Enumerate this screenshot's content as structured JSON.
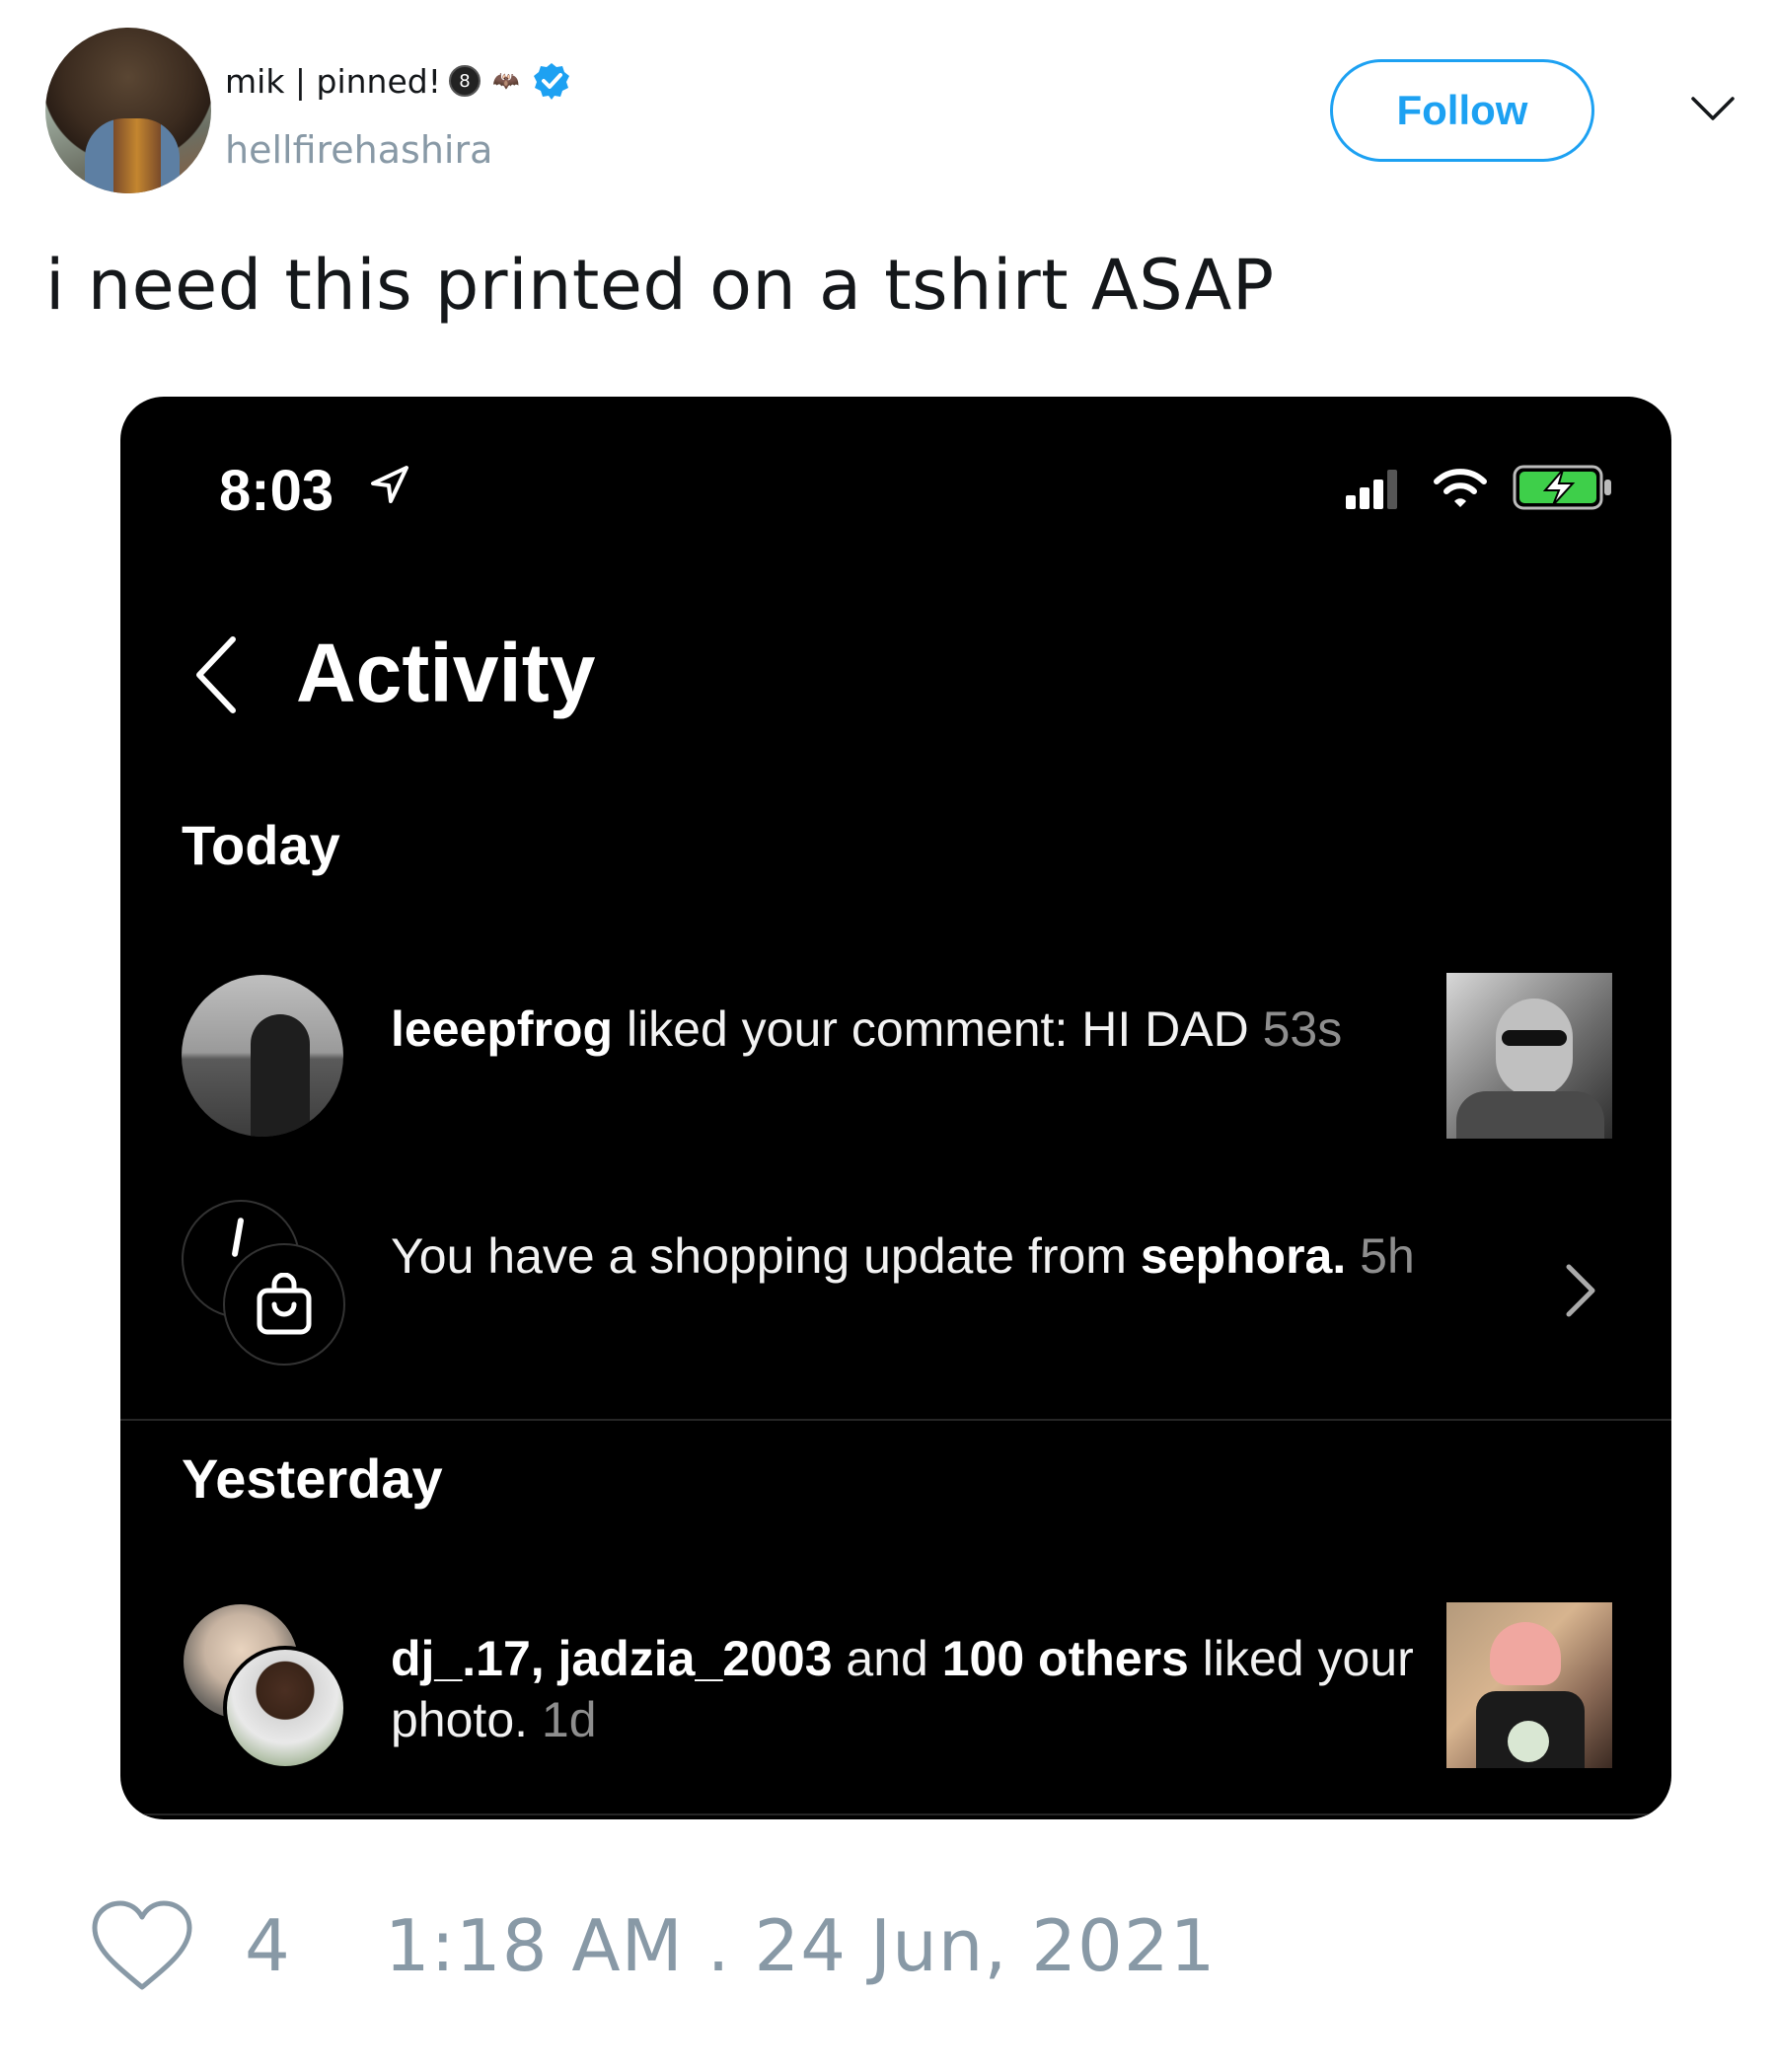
{
  "tweet": {
    "display_name": "mik | pinned!",
    "badge_8": "8",
    "handle": "hellfirehashira",
    "follow_label": "Follow",
    "text": "i need this printed on a tshirt ASAP",
    "like_count": "4",
    "timestamp": "1:18 AM . 24 Jun, 2021",
    "accent_color": "#1da1f2",
    "muted_color": "#8899a6"
  },
  "phone": {
    "status_time": "8:03",
    "title": "Activity",
    "sections": {
      "today": "Today",
      "yesterday": "Yesterday"
    },
    "items": [
      {
        "user": "leeepfrog",
        "action": " liked your comment: HI DAD",
        "time": "53s"
      },
      {
        "prefix": "You have a shopping update from ",
        "user": "sephora.",
        "time": "5h"
      },
      {
        "user": "dj_.17, jadzia_2003",
        "mid": " and ",
        "others": "100 others",
        "action": " liked your photo.",
        "time": "1d"
      }
    ],
    "background_color": "#000000"
  }
}
